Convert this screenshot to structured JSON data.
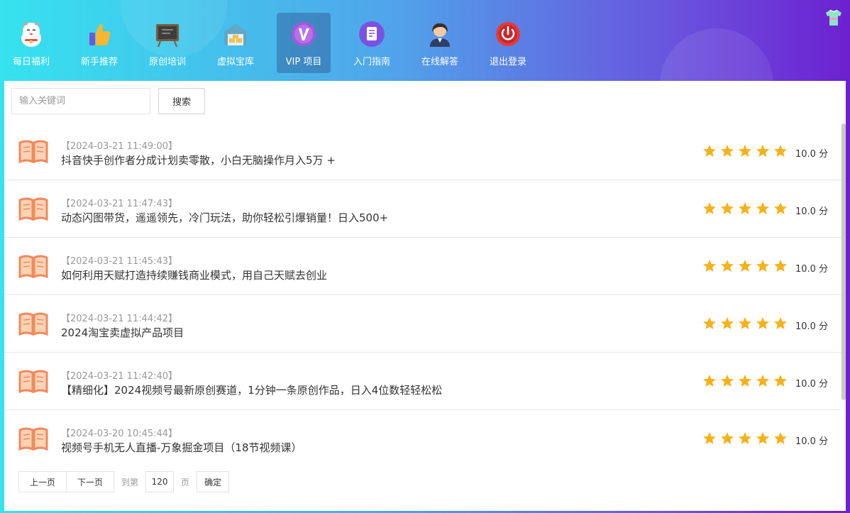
{
  "nav": {
    "items": [
      {
        "label": "每日福利",
        "icon": "lucky-cat-icon"
      },
      {
        "label": "新手推荐",
        "icon": "thumbs-up-icon"
      },
      {
        "label": "原创培训",
        "icon": "blackboard-icon"
      },
      {
        "label": "虚拟宝库",
        "icon": "treasure-warehouse-icon"
      },
      {
        "label": "VIP 项目",
        "icon": "vip-badge-icon",
        "active": true
      },
      {
        "label": "入门指南",
        "icon": "document-guide-icon"
      },
      {
        "label": "在线解答",
        "icon": "support-agent-icon"
      },
      {
        "label": "退出登录",
        "icon": "power-icon"
      }
    ],
    "skin_icon": "tshirt-skin-icon"
  },
  "search": {
    "placeholder": "输入关键词",
    "button_label": "搜索"
  },
  "list": {
    "items": [
      {
        "date": "【2024-03-21 11:49:00】",
        "title": "抖音快手创作者分成计划卖零散，小白无脑操作月入5万 +",
        "rating": 5,
        "score": "10.0 分"
      },
      {
        "date": "【2024-03-21 11:47:43】",
        "title": "动态闪图带货，遥遥领先，冷门玩法，助你轻松引爆销量！日入500+",
        "rating": 5,
        "score": "10.0 分"
      },
      {
        "date": "【2024-03-21 11:45:43】",
        "title": "如何利用天赋打造持续赚钱商业模式，用自己天赋去创业",
        "rating": 5,
        "score": "10.0 分"
      },
      {
        "date": "【2024-03-21 11:44:42】",
        "title": "2024淘宝卖虚拟产品项目",
        "rating": 5,
        "score": "10.0 分"
      },
      {
        "date": "【2024-03-21 11:42:40】",
        "title": "【精细化】2024视频号最新原创赛道，1分钟一条原创作品，日入4位数轻轻松松",
        "rating": 5,
        "score": "10.0 分"
      },
      {
        "date": "【2024-03-20 10:45:44】",
        "title": "视频号手机无人直播-万象掘金项目（18节视频课）",
        "rating": 5,
        "score": "10.0 分"
      }
    ]
  },
  "pager": {
    "prev_label": "上一页",
    "next_label": "下一页",
    "goto_label": "到第",
    "page_value": "120",
    "page_suffix": "页",
    "confirm_label": "确定"
  },
  "colors": {
    "star": "#f7b21a",
    "book": "#f08a5d",
    "accent_gradient_start": "#36e3ee",
    "accent_gradient_end": "#6d20d0"
  }
}
